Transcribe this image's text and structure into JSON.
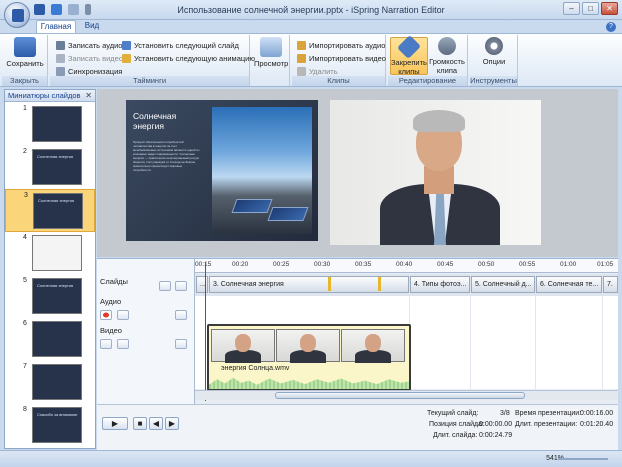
{
  "window": {
    "title": "Использование солнечной энергии.pptx - iSpring Narration Editor"
  },
  "tabs": [
    {
      "label": "Главная"
    },
    {
      "label": "Вид"
    }
  ],
  "ribbon": {
    "save": {
      "label": "Сохранить",
      "group": "Закрыть"
    },
    "timings": {
      "group": "Тайминги",
      "record_audio": "Записать аудио",
      "record_video": "Записать видео",
      "sync": "Синхронизация",
      "set_next_slide": "Установить следующий слайд",
      "set_next_animation": "Установить следующую анимацию"
    },
    "preview": "Просмотр",
    "clips": {
      "group": "Клипы",
      "import_audio": "Импортировать аудио",
      "import_video": "Импортировать видео",
      "delete": "Удалить"
    },
    "editing": {
      "group": "Редактирование",
      "pin_clips": "Закрепить клипы",
      "clip_volume": "Громкость клипа"
    },
    "tools": {
      "group": "Инструменты",
      "options": "Опции"
    }
  },
  "thumbnails_panel": {
    "title": "Миниатюры слайдов",
    "slides": [
      {
        "num": "1",
        "caption": ""
      },
      {
        "num": "2",
        "caption": "Солнечная энергия"
      },
      {
        "num": "3",
        "caption": "Солнечная энергия"
      },
      {
        "num": "4",
        "caption": ""
      },
      {
        "num": "5",
        "caption": "Солнечная энергия"
      },
      {
        "num": "6",
        "caption": ""
      },
      {
        "num": "7",
        "caption": ""
      },
      {
        "num": "8",
        "caption": "Спасибо за внимание"
      }
    ],
    "selected": 3
  },
  "slide": {
    "title": "Солнечная энергия",
    "body": "Процесс обеспечения потребностей человечества в энергии за счет возобновляемых источников является одной из ключевых задач современности. Солнечная энергия — практически неисчерпаемый ресурс. Энергия, поступающая от Солнца на Землю, значительно превосходит мировые потребности."
  },
  "timeline": {
    "labels": {
      "slides": "Слайды",
      "audio": "Аудио",
      "video": "Видео"
    },
    "ruler": [
      "00:15",
      "00:20",
      "00:25",
      "00:30",
      "00:35",
      "00:40",
      "00:45",
      "00:50",
      "00:55",
      "01:00",
      "01:05"
    ],
    "segments": [
      "...",
      "3. Солнечная энергия",
      "4. Типы фотоэ...",
      "5. Солнечный д...",
      "6. Солнечная те...",
      "7."
    ],
    "clip_name": "энергия Солнца.wmv"
  },
  "status": {
    "current_slide_label": "Текущий слайд:",
    "current_slide": "3/8",
    "slide_position_label": "Позиция слайда:",
    "slide_position": "0:00:00.00",
    "slide_duration_label": "Длит. слайда:",
    "slide_duration": "0:00:24.79",
    "presentation_time_label": "Время презентации:",
    "presentation_time": "0:00:16.00",
    "presentation_duration_label": "Длит. презентации:",
    "presentation_duration": "0:01:20.40"
  },
  "zoom": "541%",
  "colors": {
    "accent": "#15428b",
    "selected": "#fbd57a",
    "clip_border": "#3a3a3a"
  }
}
